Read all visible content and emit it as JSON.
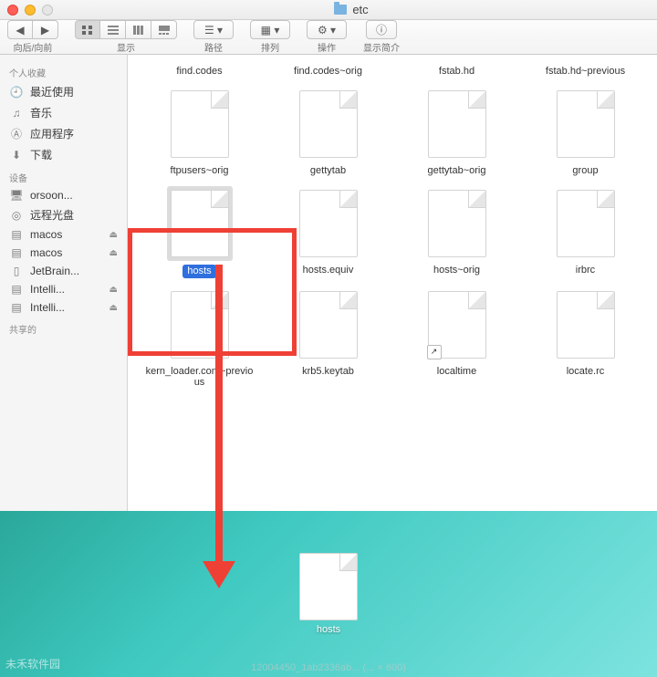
{
  "window": {
    "title": "etc"
  },
  "toolbar": {
    "nav_label": "向后/向前",
    "view_label": "显示",
    "path_label": "路径",
    "arrange_label": "排列",
    "action_label": "操作",
    "info_label": "显示简介"
  },
  "sidebar": {
    "favorites_header": "个人收藏",
    "favorites": [
      {
        "label": "最近使用",
        "icon": "clock"
      },
      {
        "label": "音乐",
        "icon": "music"
      },
      {
        "label": "应用程序",
        "icon": "apps"
      },
      {
        "label": "下载",
        "icon": "download"
      }
    ],
    "devices_header": "设备",
    "devices": [
      {
        "label": "orsoon...",
        "icon": "imac",
        "eject": false
      },
      {
        "label": "远程光盘",
        "icon": "disc",
        "eject": false
      },
      {
        "label": "macos",
        "icon": "hdd",
        "eject": true
      },
      {
        "label": "macos",
        "icon": "hdd",
        "eject": true
      },
      {
        "label": "JetBrain...",
        "icon": "doc",
        "eject": false
      },
      {
        "label": "Intelli...",
        "icon": "hdd",
        "eject": true
      },
      {
        "label": "Intelli...",
        "icon": "hdd",
        "eject": true
      }
    ],
    "shared_header": "共享的"
  },
  "files_row0": [
    {
      "label": "find.codes"
    },
    {
      "label": "find.codes~orig"
    },
    {
      "label": "fstab.hd"
    },
    {
      "label": "fstab.hd~previous"
    }
  ],
  "files_row1": [
    {
      "label": "ftpusers~orig"
    },
    {
      "label": "gettytab"
    },
    {
      "label": "gettytab~orig"
    },
    {
      "label": "group"
    }
  ],
  "files_row2": [
    {
      "label": "hosts",
      "selected": true
    },
    {
      "label": "hosts.equiv"
    },
    {
      "label": "hosts~orig"
    },
    {
      "label": "irbrc"
    }
  ],
  "files_row3": [
    {
      "label": "kern_loader.conf~previous"
    },
    {
      "label": "krb5.keytab"
    },
    {
      "label": "localtime",
      "link": true
    },
    {
      "label": "locate.rc"
    }
  ],
  "desktop_file": {
    "label": "hosts"
  },
  "watermark_corner": "未禾软件园",
  "watermark_center": "12004450_1ab2336ab... (... × 600)"
}
